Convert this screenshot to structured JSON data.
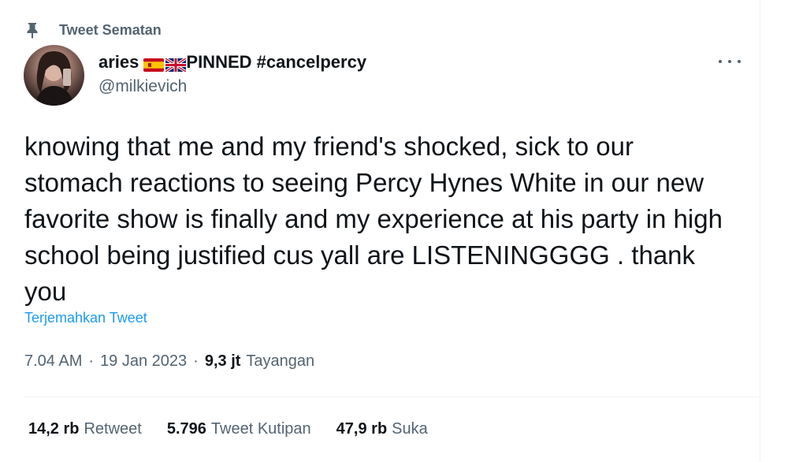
{
  "pinned_label": "Tweet Sematan",
  "author": {
    "display_name": "aries",
    "name_suffix": "PINNED #cancelpercy",
    "handle": "@milkievich",
    "flags": [
      "spain-flag",
      "uk-flag"
    ]
  },
  "tweet": {
    "text": "knowing that me and my friend's shocked, sick to our stomach reactions to seeing Percy Hynes White in our new favorite show is finally and my experience at his party in high school being justified cus yall are LISTENINGGGG . thank you",
    "translate_label": "Terjemahkan Tweet"
  },
  "meta": {
    "time": "7.04 AM",
    "separator1": "·",
    "date": "19 Jan 2023",
    "separator2": "·",
    "views_count": "9,3 jt",
    "views_label": "Tayangan"
  },
  "stats": {
    "retweets_count": "14,2 rb",
    "retweets_label": "Retweet",
    "quotes_count": "5.796",
    "quotes_label": "Tweet Kutipan",
    "likes_count": "47,9 rb",
    "likes_label": "Suka"
  },
  "colors": {
    "secondary_text": "#536471",
    "link": "#1d9bf0",
    "divider": "#eff3f4"
  }
}
